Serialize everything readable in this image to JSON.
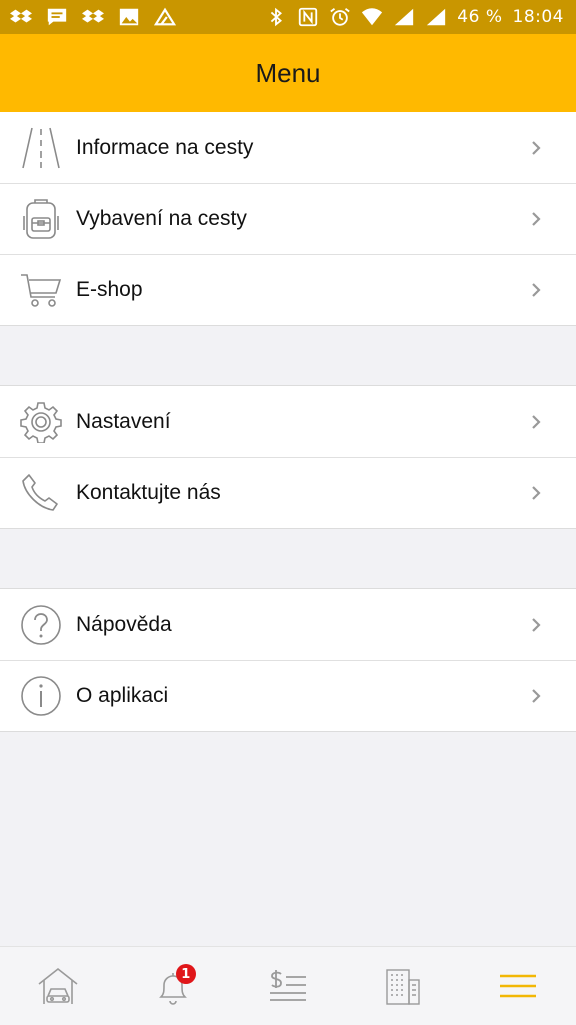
{
  "status_bar": {
    "battery": "46 %",
    "time": "18:04",
    "left_icons": [
      "dropbox-icon",
      "message-icon",
      "dropbox-icon",
      "image-icon",
      "app-icon"
    ],
    "right_icons": [
      "bluetooth-icon",
      "nfc-icon",
      "alarm-icon",
      "wifi-icon",
      "signal-icon",
      "signal-icon"
    ]
  },
  "header": {
    "title": "Menu"
  },
  "groups": [
    {
      "items": [
        {
          "label": "Informace na cesty",
          "icon": "road-icon"
        },
        {
          "label": "Vybavení na cesty",
          "icon": "backpack-icon"
        },
        {
          "label": "E-shop",
          "icon": "cart-icon"
        }
      ]
    },
    {
      "items": [
        {
          "label": "Nastavení",
          "icon": "gear-icon"
        },
        {
          "label": "Kontaktujte nás",
          "icon": "phone-icon"
        }
      ]
    },
    {
      "items": [
        {
          "label": "Nápověda",
          "icon": "help-icon"
        },
        {
          "label": "O aplikaci",
          "icon": "info-icon"
        }
      ]
    }
  ],
  "tabbar": {
    "tabs": [
      {
        "icon": "home-car-icon",
        "active": false
      },
      {
        "icon": "bell-icon",
        "active": false,
        "badge": "1"
      },
      {
        "icon": "price-list-icon",
        "active": false
      },
      {
        "icon": "building-icon",
        "active": false
      },
      {
        "icon": "menu-icon",
        "active": true
      }
    ],
    "active_color": "#f2b705",
    "inactive_color": "#9a9a9a"
  },
  "colors": {
    "header": "#ffb900",
    "status_bar": "#c99600",
    "badge": "#e0161a"
  }
}
